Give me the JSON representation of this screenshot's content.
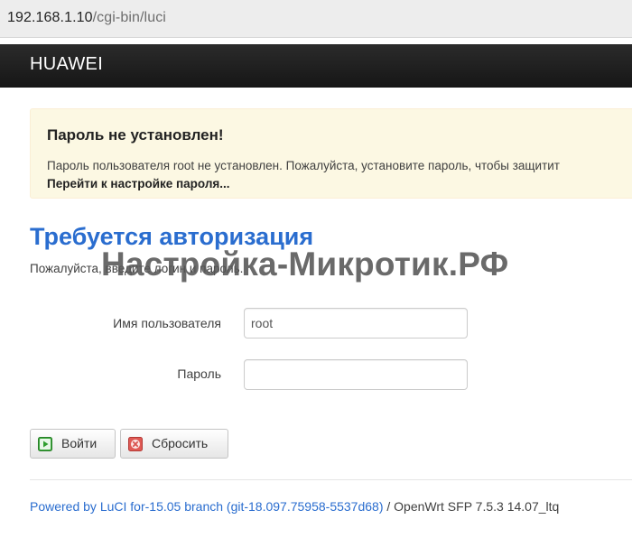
{
  "browser": {
    "url_host": "192.168.1.10",
    "url_path": "/cgi-bin/luci"
  },
  "header": {
    "brand": "HUAWEI"
  },
  "alert": {
    "title": "Пароль не установлен!",
    "message": "Пароль пользователя root не установлен. Пожалуйста, установите пароль, чтобы защитит",
    "link_label": "Перейти к настройке пароля..."
  },
  "login": {
    "title": "Требуется авторизация",
    "hint": "Пожалуйста, введите логин и пароль.",
    "username_label": "Имя пользователя",
    "username_value": "root",
    "password_label": "Пароль",
    "password_value": "",
    "login_button": "Войти",
    "reset_button": "Сбросить"
  },
  "watermark": {
    "text": "Настройка-Микротик.РФ"
  },
  "footer": {
    "link_text": "Powered by LuCI for-15.05 branch (git-18.097.75958-5537d68)",
    "suffix_text": " / OpenWrt SFP 7.5.3 14.07_ltq"
  },
  "colors": {
    "accent": "#2a6dcf",
    "header_bg": "#1e1e1e",
    "alert_bg": "#fcf8e3",
    "login_icon": "#2f9e2f",
    "reset_icon": "#d9534f"
  },
  "icons": {
    "login_icon": "play-icon",
    "reset_icon": "close-icon"
  }
}
